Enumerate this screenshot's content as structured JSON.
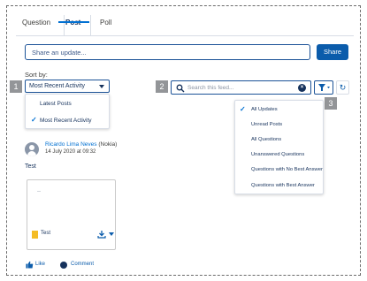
{
  "tabs": [
    {
      "label": "Question",
      "active": false
    },
    {
      "label": "Post",
      "active": true
    },
    {
      "label": "Poll",
      "active": false
    }
  ],
  "composer": {
    "placeholder": "Share an update...",
    "share_label": "Share"
  },
  "sort": {
    "label": "Sort by:",
    "selected": "Most Recent Activity",
    "options": [
      "Latest Posts",
      "Most Recent Activity"
    ]
  },
  "search": {
    "placeholder": "Search this feed..."
  },
  "filter": {
    "selected": "All Updates",
    "options": [
      "All Updates",
      "Unread Posts",
      "All Questions",
      "Unanswered Questions",
      "Questions with No Best Answer",
      "Questions with Best Answer"
    ]
  },
  "badges": [
    "1",
    "2",
    "3"
  ],
  "post": {
    "author": "Ricardo Lima Neves",
    "org": "(Nokia)",
    "date": "14 July 2020 at 09:32",
    "text": "Test",
    "attachment": {
      "preview": "--",
      "name": "Test"
    },
    "like_label": "Like",
    "comment_label": "Comment"
  },
  "icons": {
    "search": "search-icon",
    "clear": "clear-icon",
    "filter": "filter-icon",
    "refresh": "refresh-icon",
    "download": "download-icon",
    "like": "thumbs-up-icon",
    "comment": "comment-icon",
    "check": "check-icon"
  },
  "colors": {
    "brand": "#0b5cab",
    "link": "#0070d2",
    "text": "#16325c",
    "badge": "#939598"
  }
}
